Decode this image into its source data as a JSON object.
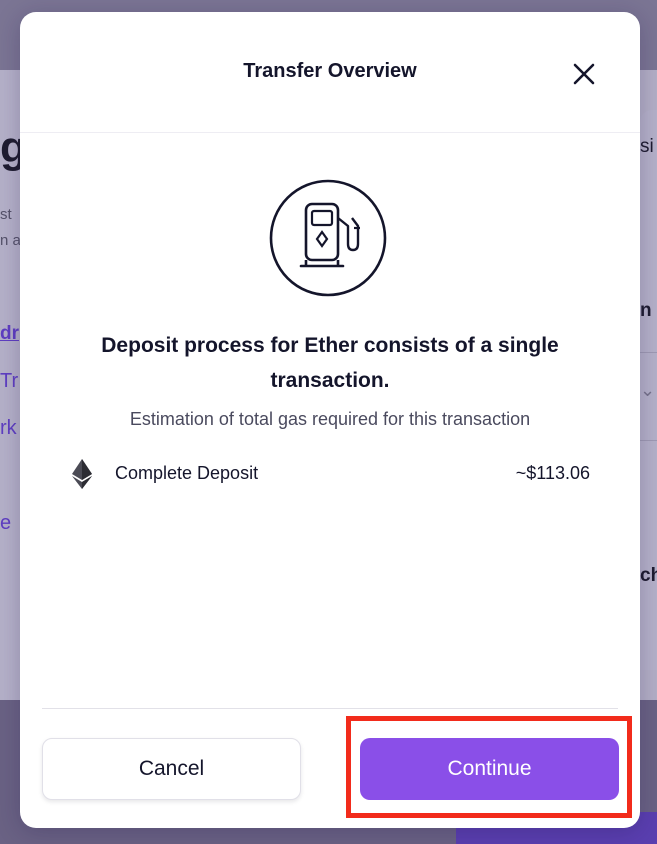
{
  "background": {
    "heading_fragment": "g",
    "text_fragment_1": "st",
    "text_fragment_2": "n a",
    "link_fragment_1": "dr",
    "link_fragment_2": "Tr",
    "link_fragment_3": "rk",
    "link_fragment_4": "e",
    "right_fragment_1": "si",
    "right_fragment_2": "n c",
    "right_fragment_3": "cha"
  },
  "modal": {
    "title": "Transfer Overview",
    "message": "Deposit process for Ether consists of a single transaction.",
    "subtitle": "Estimation of total gas required for this transaction",
    "transactions": [
      {
        "token_icon": "ethereum-icon",
        "label": "Complete Deposit",
        "cost": "~$113.06"
      }
    ],
    "cancel_label": "Cancel",
    "continue_label": "Continue"
  },
  "colors": {
    "accent": "#8a4fe8",
    "highlight": "#f22b1b",
    "overlay": "#b3afc6"
  }
}
